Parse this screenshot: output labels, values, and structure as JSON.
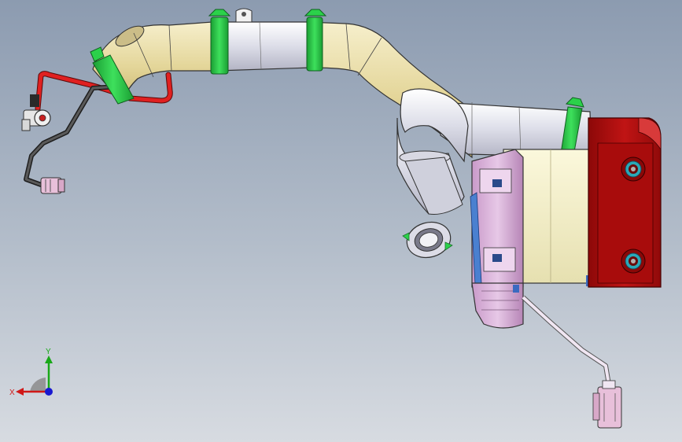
{
  "colors": {
    "background_top": "#8c9bb0",
    "background_bottom": "#d7dbe1",
    "duct_yellow": "#eadfa8",
    "duct_white": "#e9eaf2",
    "clamp_green": "#2bd14a",
    "housing_red": "#b80f0f",
    "blower_pink": "#d9b3d9",
    "hose_red": "#e02020",
    "hose_dark": "#3a3a3a",
    "connector_pink": "#e8c0da",
    "axis_x": "#d01818",
    "axis_y": "#18a818",
    "axis_z": "#1818d0"
  },
  "triad": {
    "x_label": "X",
    "y_label": "Y"
  },
  "icons": {
    "triad": "coordinate-triad-icon"
  }
}
